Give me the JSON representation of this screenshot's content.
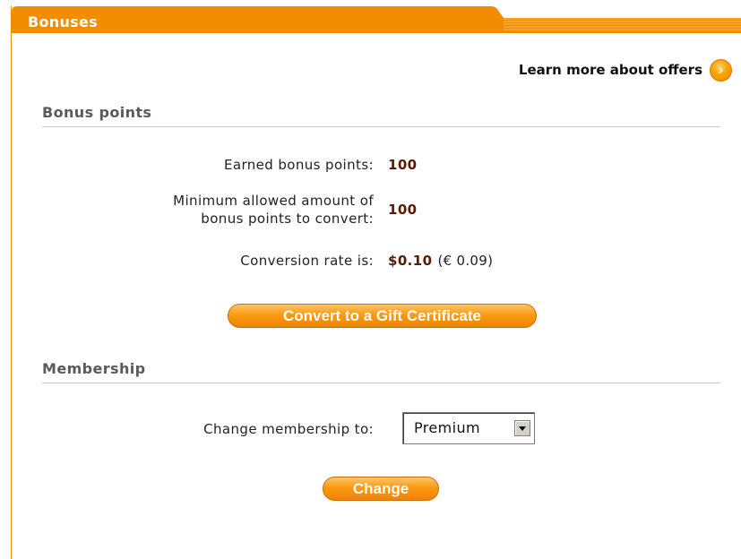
{
  "tab": {
    "title": "Bonuses"
  },
  "learn_more": {
    "label": "Learn more about offers",
    "icon": "chevron-right-icon"
  },
  "bonus_section": {
    "title": "Bonus points",
    "earned_label": "Earned bonus points:",
    "earned_value": "100",
    "minimum_label_line1": "Minimum allowed amount of",
    "minimum_label_line2": "bonus points to convert:",
    "minimum_value": "100",
    "rate_label": "Conversion rate is:",
    "rate_value": "$0.10",
    "rate_alt": "(€ 0.09)",
    "convert_button": "Convert to a Gift Certificate"
  },
  "membership_section": {
    "title": "Membership",
    "change_label": "Change membership to:",
    "selected": "Premium",
    "change_button": "Change"
  },
  "colors": {
    "accent": "#f28c00",
    "value": "#5a1a00",
    "section_title": "#5a5a5a"
  }
}
